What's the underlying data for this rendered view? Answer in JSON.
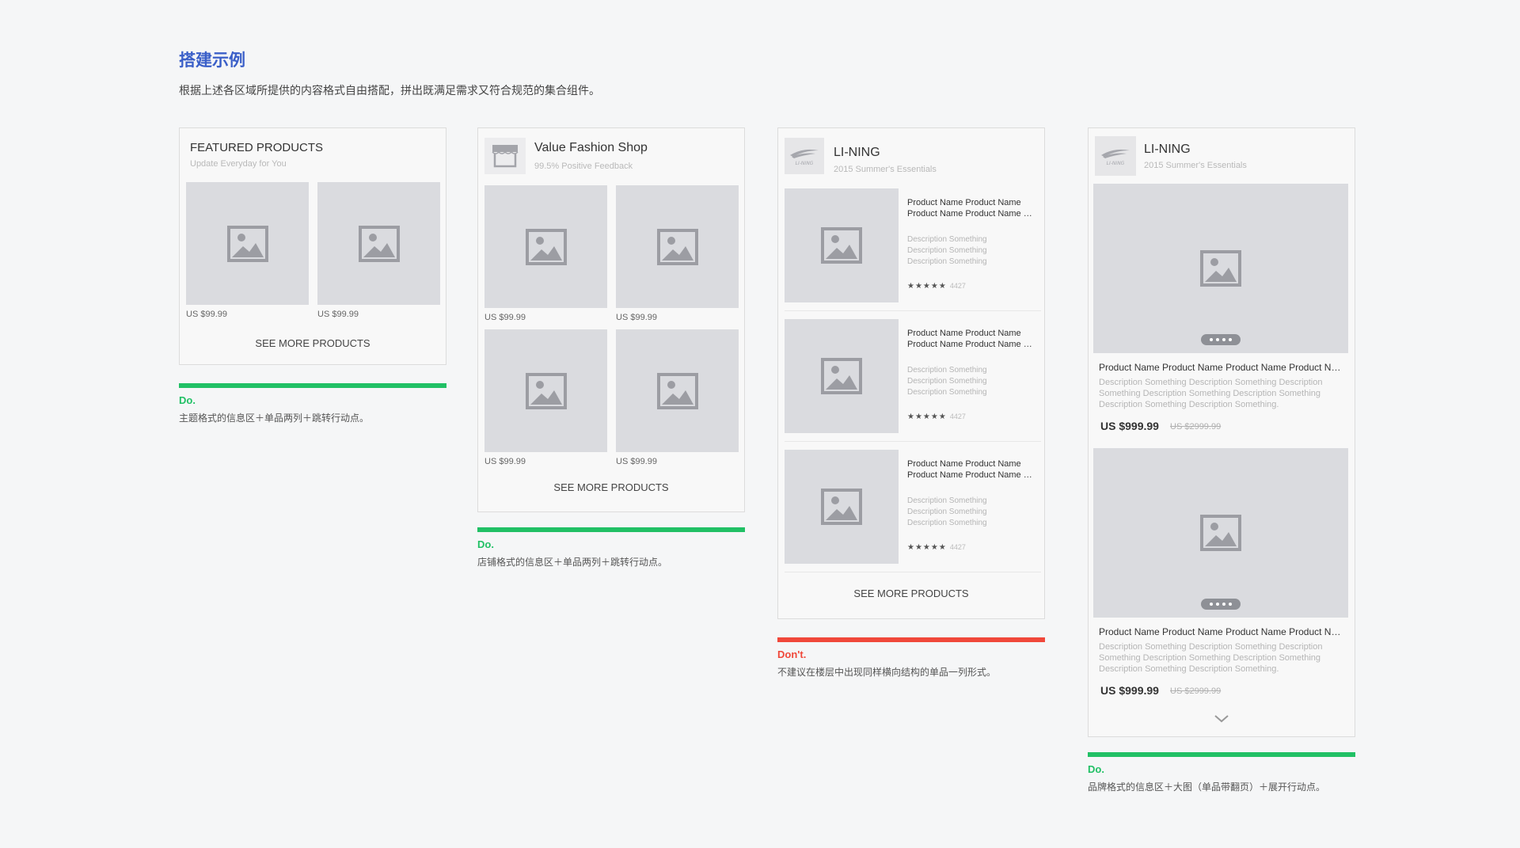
{
  "header": {
    "title": "搭建示例",
    "subtitle": "根据上述各区域所提供的内容格式自由搭配，拼出既满足需求又符合规范的集合组件。"
  },
  "colors": {
    "accent": "#3a5fc8",
    "do": "#21c065",
    "dont": "#f0483a",
    "placeholder": "#dadbdf"
  },
  "icons": [
    "image-placeholder-icon",
    "shop-icon",
    "li-ning-logo",
    "chevron-down-icon",
    "star-icon"
  ],
  "card1": {
    "title": "FEATURED PRODUCTS",
    "subtitle": "Update Everyday for You",
    "prices": [
      "US $99.99",
      "US $99.99"
    ],
    "see_more": "SEE MORE PRODUCTS",
    "verdict": "Do.",
    "desc": "主题格式的信息区＋单品两列＋跳转行动点。"
  },
  "card2": {
    "title": "Value Fashion Shop",
    "subtitle": "99.5% Positive Feedback",
    "prices": [
      "US $99.99",
      "US $99.99",
      "US $99.99",
      "US $99.99"
    ],
    "see_more": "SEE MORE PRODUCTS",
    "verdict": "Do.",
    "desc": "店铺格式的信息区＋单品两列＋跳转行动点。"
  },
  "card3": {
    "title": "LI-NING",
    "subtitle": "2015 Summer's Essentials",
    "logo_text": "LI-NING",
    "items": [
      {
        "name1": "Product Name Product Name",
        "name2": "Product Name Product Name Product Name",
        "desc": [
          "Description Something",
          "Description Something",
          "Description Something"
        ],
        "stars": "★★★★★",
        "count": "4427"
      },
      {
        "name1": "Product Name Product Name",
        "name2": "Product Name Product Name Product Name",
        "desc": [
          "Description Something",
          "Description Something",
          "Description Something"
        ],
        "stars": "★★★★★",
        "count": "4427"
      },
      {
        "name1": "Product Name Product Name",
        "name2": "Product Name Product Name Product Name",
        "desc": [
          "Description Something",
          "Description Something",
          "Description Something"
        ],
        "stars": "★★★★★",
        "count": "4427"
      }
    ],
    "see_more": "SEE MORE PRODUCTS",
    "verdict": "Don't.",
    "desc": "不建议在楼层中出现同样横向结构的单品一列形式。"
  },
  "card4": {
    "title": "LI-NING",
    "subtitle": "2015 Summer's Essentials",
    "logo_text": "LI-NING",
    "items": [
      {
        "name": "Product Name Product Name Product Name Product Name",
        "desc": [
          "Description Something Description Something Description",
          "Something Description Something Description Something",
          "Description Something Description Something."
        ],
        "price": "US $999.99",
        "old_price": "US $2999.99"
      },
      {
        "name": "Product Name Product Name Product Name Product Name",
        "desc": [
          "Description Something Description Something Description",
          "Something Description Something Description Something",
          "Description Something Description Something."
        ],
        "price": "US $999.99",
        "old_price": "US $2999.99"
      }
    ],
    "verdict": "Do.",
    "desc": "品牌格式的信息区＋大图（单品带翻页）＋展开行动点。"
  }
}
